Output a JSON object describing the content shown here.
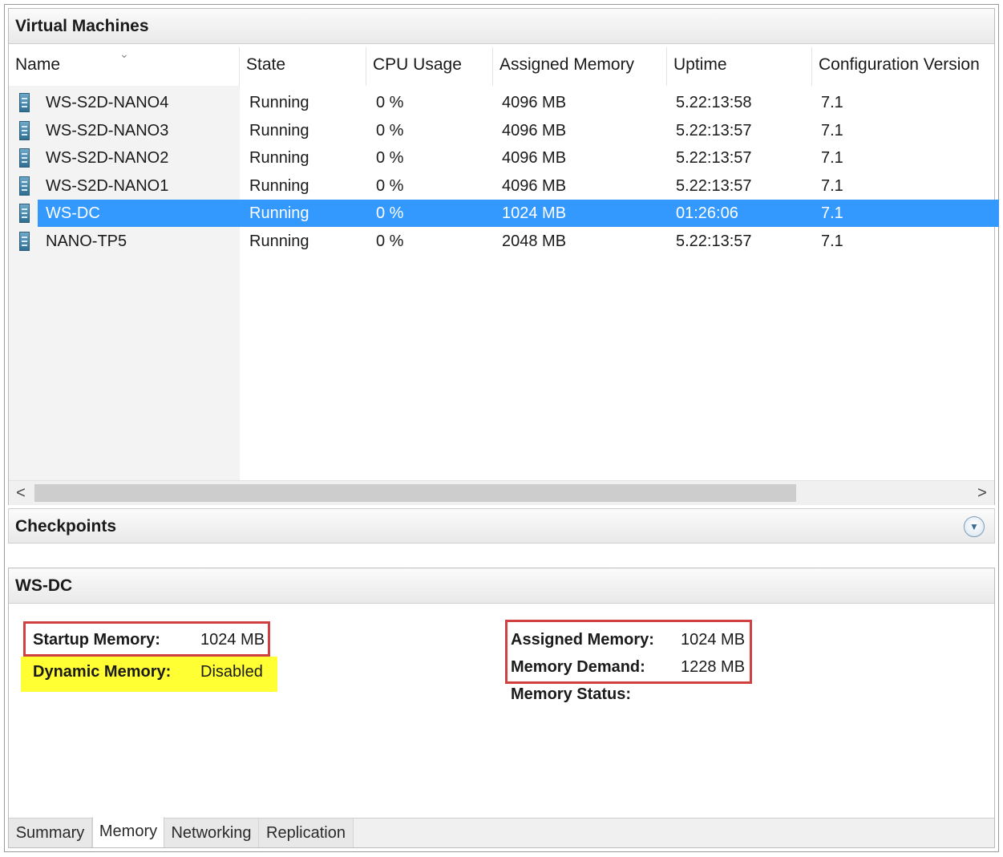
{
  "vm_panel": {
    "title": "Virtual Machines",
    "columns": [
      "Name",
      "State",
      "CPU Usage",
      "Assigned Memory",
      "Uptime",
      "Configuration Version"
    ],
    "rows": [
      {
        "name": "WS-S2D-NANO4",
        "state": "Running",
        "cpu": "0 %",
        "memory": "4096 MB",
        "uptime": "5.22:13:58",
        "version": "7.1"
      },
      {
        "name": "WS-S2D-NANO3",
        "state": "Running",
        "cpu": "0 %",
        "memory": "4096 MB",
        "uptime": "5.22:13:57",
        "version": "7.1"
      },
      {
        "name": "WS-S2D-NANO2",
        "state": "Running",
        "cpu": "0 %",
        "memory": "4096 MB",
        "uptime": "5.22:13:57",
        "version": "7.1"
      },
      {
        "name": "WS-S2D-NANO1",
        "state": "Running",
        "cpu": "0 %",
        "memory": "4096 MB",
        "uptime": "5.22:13:57",
        "version": "7.1"
      },
      {
        "name": "WS-DC",
        "state": "Running",
        "cpu": "0 %",
        "memory": "1024 MB",
        "uptime": "01:26:06",
        "version": "7.1"
      },
      {
        "name": "NANO-TP5",
        "state": "Running",
        "cpu": "0 %",
        "memory": "2048 MB",
        "uptime": "5.22:13:57",
        "version": "7.1"
      }
    ],
    "selected_row": 4,
    "scroll_left_glyph": "<",
    "scroll_right_glyph": ">"
  },
  "checkpoints": {
    "title": "Checkpoints",
    "expand_icon": "chevron-down-circle-icon"
  },
  "details": {
    "title": "WS-DC",
    "startup_memory_label": "Startup Memory:",
    "startup_memory_value": "1024 MB",
    "dynamic_memory_label": "Dynamic Memory:",
    "dynamic_memory_value": "Disabled",
    "assigned_memory_label": "Assigned Memory:",
    "assigned_memory_value": "1024 MB",
    "memory_demand_label": "Memory Demand:",
    "memory_demand_value": "1228 MB",
    "memory_status_label": "Memory Status:",
    "tabs": [
      "Summary",
      "Memory",
      "Networking",
      "Replication"
    ],
    "active_tab": "Memory"
  },
  "colors": {
    "selection": "#3399ff",
    "highlight_red": "#d04040",
    "highlight_yellow": "#ffff33"
  }
}
